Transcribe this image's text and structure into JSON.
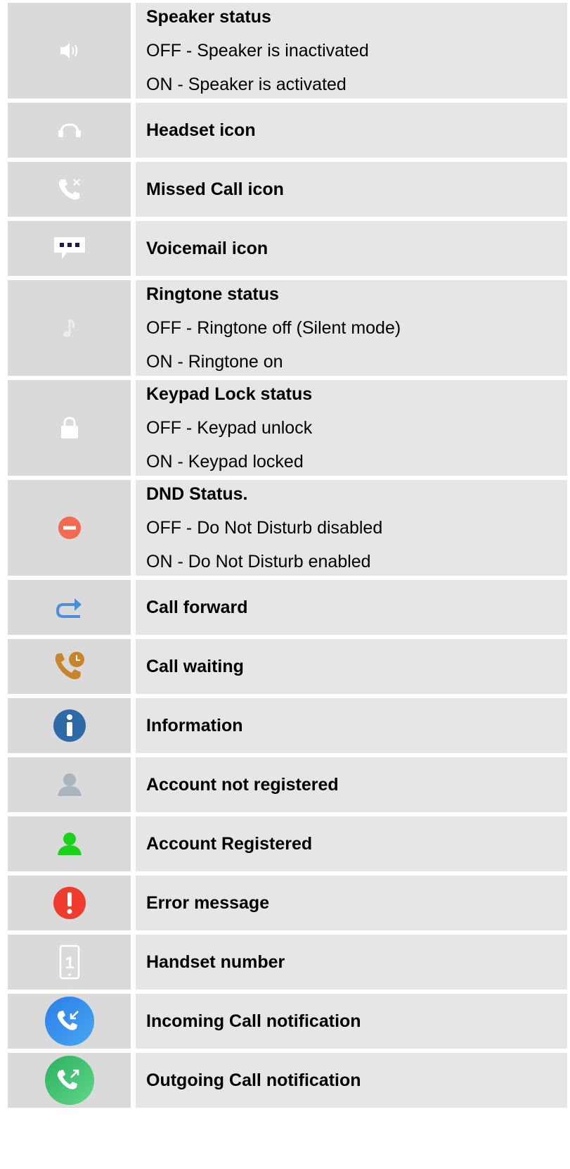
{
  "rows": [
    {
      "icon": "speaker-icon",
      "title": "Speaker status",
      "lines": [
        "OFF - Speaker is inactivated",
        "ON - Speaker is activated"
      ]
    },
    {
      "icon": "headset-icon",
      "title": "Headset icon",
      "lines": []
    },
    {
      "icon": "missed-call-icon",
      "title": "Missed Call icon",
      "lines": []
    },
    {
      "icon": "voicemail-icon",
      "title": "Voicemail icon",
      "lines": []
    },
    {
      "icon": "ringtone-icon",
      "title": "Ringtone status",
      "lines": [
        "OFF - Ringtone off (Silent mode)",
        "ON - Ringtone on"
      ]
    },
    {
      "icon": "lock-icon",
      "title": "Keypad Lock status",
      "lines": [
        "OFF - Keypad unlock",
        "ON - Keypad locked"
      ]
    },
    {
      "icon": "dnd-icon",
      "title": "DND Status.",
      "lines": [
        "OFF - Do Not Disturb disabled",
        "ON - Do Not Disturb enabled"
      ]
    },
    {
      "icon": "call-forward-icon",
      "title": "Call forward",
      "lines": []
    },
    {
      "icon": "call-waiting-icon",
      "title": "Call waiting",
      "lines": []
    },
    {
      "icon": "information-icon",
      "title": "Information",
      "lines": []
    },
    {
      "icon": "account-not-registered-icon",
      "title": "Account not registered",
      "lines": []
    },
    {
      "icon": "account-registered-icon",
      "title": "Account Registered",
      "lines": []
    },
    {
      "icon": "error-icon",
      "title": "Error message",
      "lines": []
    },
    {
      "icon": "handset-number-icon",
      "title": "Handset number",
      "lines": [
        "1"
      ]
    },
    {
      "icon": "incoming-call-icon",
      "title": "Incoming Call notification",
      "lines": []
    },
    {
      "icon": "outgoing-call-icon",
      "title": "Outgoing Call notification",
      "lines": []
    }
  ],
  "colors": {
    "icon_cell_bg": "#dadada",
    "desc_cell_bg": "#e6e6e6",
    "dnd": "#f26a4f",
    "forward": "#4a90d9",
    "waiting": "#c8862a",
    "info": "#2e6aa8",
    "not_registered": "#a9b4bd",
    "registered": "#19d31b",
    "error": "#f03c2e"
  }
}
